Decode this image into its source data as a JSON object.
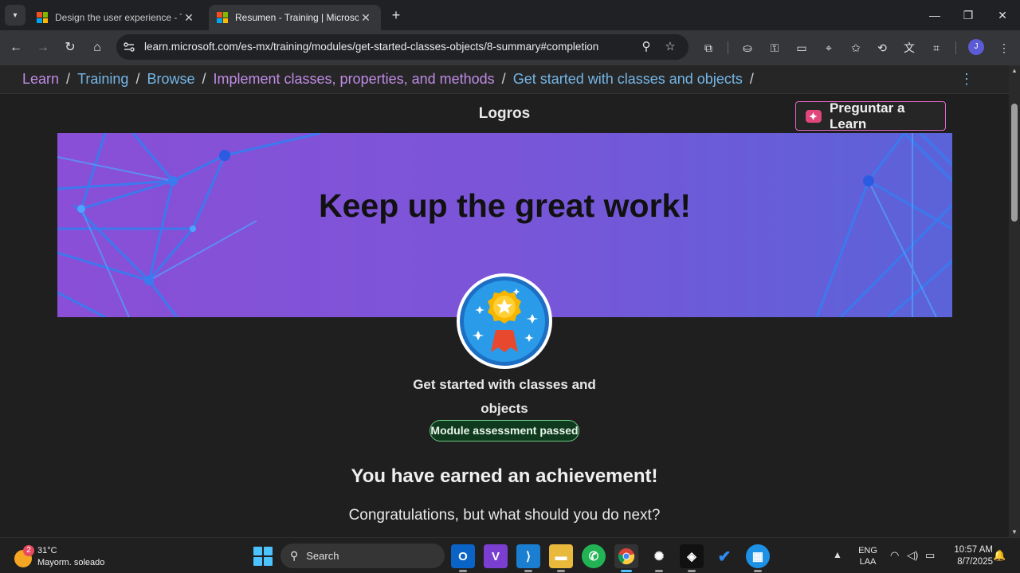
{
  "browser": {
    "tabs": [
      {
        "title": "Design the user experience - Tr",
        "active": false
      },
      {
        "title": "Resumen - Training | Microsoft L",
        "active": true
      }
    ],
    "url": "learn.microsoft.com/es-mx/training/modules/get-started-classes-objects/8-summary#completion",
    "profile_initial": "J"
  },
  "breadcrumbs": [
    "Learn",
    "Training",
    "Browse",
    "Implement classes, properties, and methods",
    "Get started with classes and objects"
  ],
  "breadcrumb_separator": "/",
  "page": {
    "section_title": "Logros",
    "ask_button": "Preguntar a Learn",
    "banner_title": "Keep up the great work!",
    "module_name": "Get started with classes and objects",
    "status_pill": "Module assessment passed",
    "earned_heading": "You have earned an achievement!",
    "next_text": "Congratulations, but what should you do next?"
  },
  "taskbar": {
    "weather_temp": "31°C",
    "weather_condition": "Mayorm. soleado",
    "weather_badge": "2",
    "search_placeholder": "Search",
    "lang_line1": "ENG",
    "lang_line2": "LAA",
    "time": "10:57 AM",
    "date": "8/7/2025"
  },
  "colors": {
    "link": "#75b6e7",
    "visited_link": "#c08be6",
    "banner_start": "#8a4fd6",
    "banner_end": "#5b63d8",
    "pass_border": "#6cc983",
    "accent": "#e567c6"
  }
}
